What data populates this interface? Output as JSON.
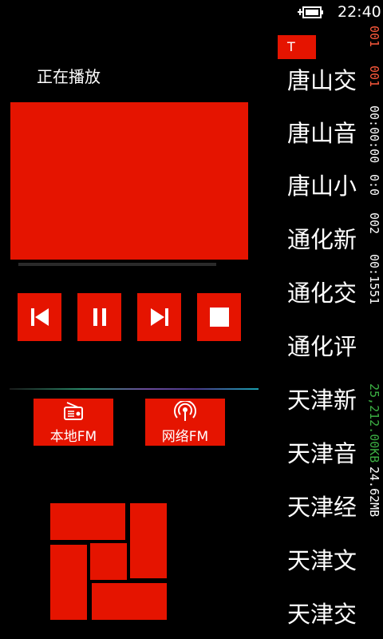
{
  "status": {
    "time": "22:40"
  },
  "player": {
    "title": "正在播放",
    "progress_fraction": 0.0
  },
  "controls": {
    "previous": "previous-icon",
    "pause": "pause-icon",
    "next": "next-icon",
    "stop": "stop-icon"
  },
  "sources": [
    {
      "label": "本地FM",
      "icon": "radio-icon"
    },
    {
      "label": "网络FM",
      "icon": "broadcast-icon"
    }
  ],
  "stations": [
    "唐山交",
    "唐山音",
    "唐山小",
    "通化新",
    "通化交",
    "通化评",
    "天津新",
    "天津音",
    "天津经",
    "天津文",
    "天津交"
  ],
  "scroll_badge": "T",
  "debug": {
    "line1": "001",
    "line2": "001",
    "line3": "00:00:00",
    "line4": "0:0",
    "line5": "002",
    "line6": "00:1551",
    "memory_used": "25,212.00KB",
    "memory_total": "24.62MB"
  },
  "colors": {
    "accent": "#e51400",
    "background": "#000000",
    "text": "#ffffff",
    "debug_green": "#3cb043",
    "debug_red": "#ff5a3c"
  }
}
